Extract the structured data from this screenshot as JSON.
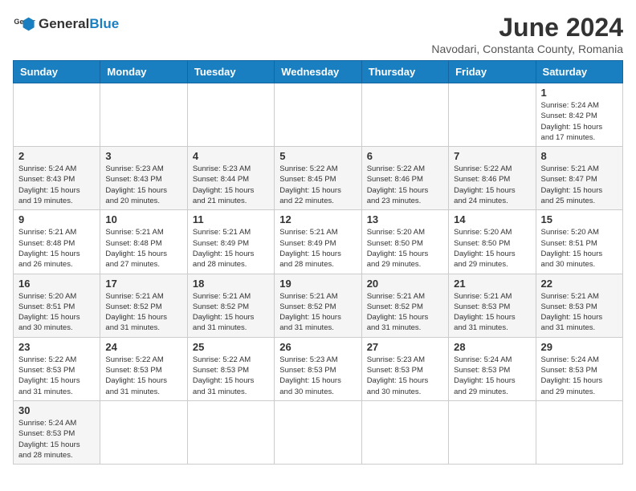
{
  "header": {
    "logo": {
      "text_general": "General",
      "text_blue": "Blue"
    },
    "title": "June 2024",
    "location": "Navodari, Constanta County, Romania"
  },
  "weekdays": [
    "Sunday",
    "Monday",
    "Tuesday",
    "Wednesday",
    "Thursday",
    "Friday",
    "Saturday"
  ],
  "weeks": [
    [
      {
        "day": "",
        "info": ""
      },
      {
        "day": "",
        "info": ""
      },
      {
        "day": "",
        "info": ""
      },
      {
        "day": "",
        "info": ""
      },
      {
        "day": "",
        "info": ""
      },
      {
        "day": "",
        "info": ""
      },
      {
        "day": "1",
        "info": "Sunrise: 5:24 AM\nSunset: 8:42 PM\nDaylight: 15 hours\nand 17 minutes."
      }
    ],
    [
      {
        "day": "2",
        "info": "Sunrise: 5:24 AM\nSunset: 8:43 PM\nDaylight: 15 hours\nand 19 minutes."
      },
      {
        "day": "3",
        "info": "Sunrise: 5:23 AM\nSunset: 8:43 PM\nDaylight: 15 hours\nand 20 minutes."
      },
      {
        "day": "4",
        "info": "Sunrise: 5:23 AM\nSunset: 8:44 PM\nDaylight: 15 hours\nand 21 minutes."
      },
      {
        "day": "5",
        "info": "Sunrise: 5:22 AM\nSunset: 8:45 PM\nDaylight: 15 hours\nand 22 minutes."
      },
      {
        "day": "6",
        "info": "Sunrise: 5:22 AM\nSunset: 8:46 PM\nDaylight: 15 hours\nand 23 minutes."
      },
      {
        "day": "7",
        "info": "Sunrise: 5:22 AM\nSunset: 8:46 PM\nDaylight: 15 hours\nand 24 minutes."
      },
      {
        "day": "8",
        "info": "Sunrise: 5:21 AM\nSunset: 8:47 PM\nDaylight: 15 hours\nand 25 minutes."
      }
    ],
    [
      {
        "day": "9",
        "info": "Sunrise: 5:21 AM\nSunset: 8:48 PM\nDaylight: 15 hours\nand 26 minutes."
      },
      {
        "day": "10",
        "info": "Sunrise: 5:21 AM\nSunset: 8:48 PM\nDaylight: 15 hours\nand 27 minutes."
      },
      {
        "day": "11",
        "info": "Sunrise: 5:21 AM\nSunset: 8:49 PM\nDaylight: 15 hours\nand 28 minutes."
      },
      {
        "day": "12",
        "info": "Sunrise: 5:21 AM\nSunset: 8:49 PM\nDaylight: 15 hours\nand 28 minutes."
      },
      {
        "day": "13",
        "info": "Sunrise: 5:20 AM\nSunset: 8:50 PM\nDaylight: 15 hours\nand 29 minutes."
      },
      {
        "day": "14",
        "info": "Sunrise: 5:20 AM\nSunset: 8:50 PM\nDaylight: 15 hours\nand 29 minutes."
      },
      {
        "day": "15",
        "info": "Sunrise: 5:20 AM\nSunset: 8:51 PM\nDaylight: 15 hours\nand 30 minutes."
      }
    ],
    [
      {
        "day": "16",
        "info": "Sunrise: 5:20 AM\nSunset: 8:51 PM\nDaylight: 15 hours\nand 30 minutes."
      },
      {
        "day": "17",
        "info": "Sunrise: 5:21 AM\nSunset: 8:52 PM\nDaylight: 15 hours\nand 31 minutes."
      },
      {
        "day": "18",
        "info": "Sunrise: 5:21 AM\nSunset: 8:52 PM\nDaylight: 15 hours\nand 31 minutes."
      },
      {
        "day": "19",
        "info": "Sunrise: 5:21 AM\nSunset: 8:52 PM\nDaylight: 15 hours\nand 31 minutes."
      },
      {
        "day": "20",
        "info": "Sunrise: 5:21 AM\nSunset: 8:52 PM\nDaylight: 15 hours\nand 31 minutes."
      },
      {
        "day": "21",
        "info": "Sunrise: 5:21 AM\nSunset: 8:53 PM\nDaylight: 15 hours\nand 31 minutes."
      },
      {
        "day": "22",
        "info": "Sunrise: 5:21 AM\nSunset: 8:53 PM\nDaylight: 15 hours\nand 31 minutes."
      }
    ],
    [
      {
        "day": "23",
        "info": "Sunrise: 5:22 AM\nSunset: 8:53 PM\nDaylight: 15 hours\nand 31 minutes."
      },
      {
        "day": "24",
        "info": "Sunrise: 5:22 AM\nSunset: 8:53 PM\nDaylight: 15 hours\nand 31 minutes."
      },
      {
        "day": "25",
        "info": "Sunrise: 5:22 AM\nSunset: 8:53 PM\nDaylight: 15 hours\nand 31 minutes."
      },
      {
        "day": "26",
        "info": "Sunrise: 5:23 AM\nSunset: 8:53 PM\nDaylight: 15 hours\nand 30 minutes."
      },
      {
        "day": "27",
        "info": "Sunrise: 5:23 AM\nSunset: 8:53 PM\nDaylight: 15 hours\nand 30 minutes."
      },
      {
        "day": "28",
        "info": "Sunrise: 5:24 AM\nSunset: 8:53 PM\nDaylight: 15 hours\nand 29 minutes."
      },
      {
        "day": "29",
        "info": "Sunrise: 5:24 AM\nSunset: 8:53 PM\nDaylight: 15 hours\nand 29 minutes."
      }
    ],
    [
      {
        "day": "30",
        "info": "Sunrise: 5:24 AM\nSunset: 8:53 PM\nDaylight: 15 hours\nand 28 minutes."
      },
      {
        "day": "",
        "info": ""
      },
      {
        "day": "",
        "info": ""
      },
      {
        "day": "",
        "info": ""
      },
      {
        "day": "",
        "info": ""
      },
      {
        "day": "",
        "info": ""
      },
      {
        "day": "",
        "info": ""
      }
    ]
  ]
}
